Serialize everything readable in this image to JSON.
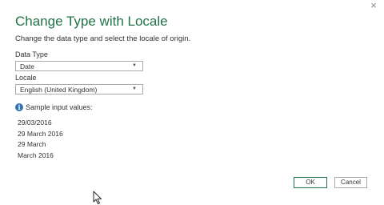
{
  "dialog": {
    "close_symbol": "×",
    "title": "Change Type with Locale",
    "subtitle": "Change the data type and select the locale of origin."
  },
  "data_type": {
    "label": "Data Type",
    "selected": "Date"
  },
  "locale": {
    "label": "Locale",
    "selected": "English (United Kingdom)"
  },
  "samples": {
    "icon": "info-icon",
    "label": "Sample input values:",
    "values": [
      "29/03/2016",
      "29 March 2016",
      "29 March",
      "March 2016"
    ]
  },
  "buttons": {
    "ok_label": "OK",
    "cancel_label": "Cancel"
  },
  "colors": {
    "title": "#217346",
    "info_icon": "#2e75b6",
    "ok_border": "#217346"
  }
}
